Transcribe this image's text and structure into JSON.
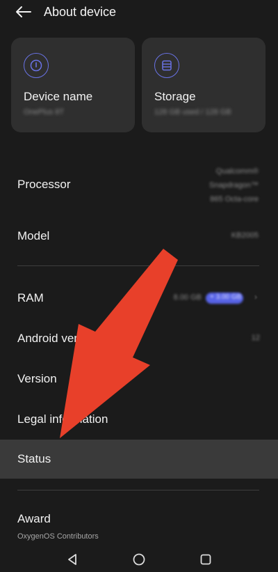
{
  "header": {
    "title": "About device",
    "back_icon": "back-arrow-icon"
  },
  "cards": [
    {
      "title": "Device name",
      "value": "OnePlus 8T",
      "icon": "info-icon"
    },
    {
      "title": "Storage",
      "value": "128 GB used / 128 GB",
      "icon": "storage-icon"
    }
  ],
  "rows": {
    "processor": {
      "label": "Processor",
      "value_lines": [
        "Qualcomm®",
        "Snapdragon™",
        "865 Octa-core"
      ]
    },
    "model": {
      "label": "Model",
      "value": "KB2005"
    },
    "ram": {
      "label": "RAM",
      "value": "8.00 GB",
      "badge": "+ 3.00 GB"
    },
    "android_version": {
      "label": "Android version",
      "value": "12"
    },
    "version": {
      "label": "Version"
    },
    "legal": {
      "label": "Legal information"
    },
    "status": {
      "label": "Status"
    },
    "award": {
      "label": "Award",
      "sub": "OxygenOS Contributors"
    }
  },
  "navbar": {
    "back_icon": "nav-back-icon",
    "home_icon": "nav-home-icon",
    "recents_icon": "nav-recents-icon"
  },
  "colors": {
    "background": "#1b1b1b",
    "card": "#2f2f2f",
    "accent": "#6a73e6",
    "highlight_row": "#3a3a3a",
    "annotation_arrow": "#e8402a"
  }
}
